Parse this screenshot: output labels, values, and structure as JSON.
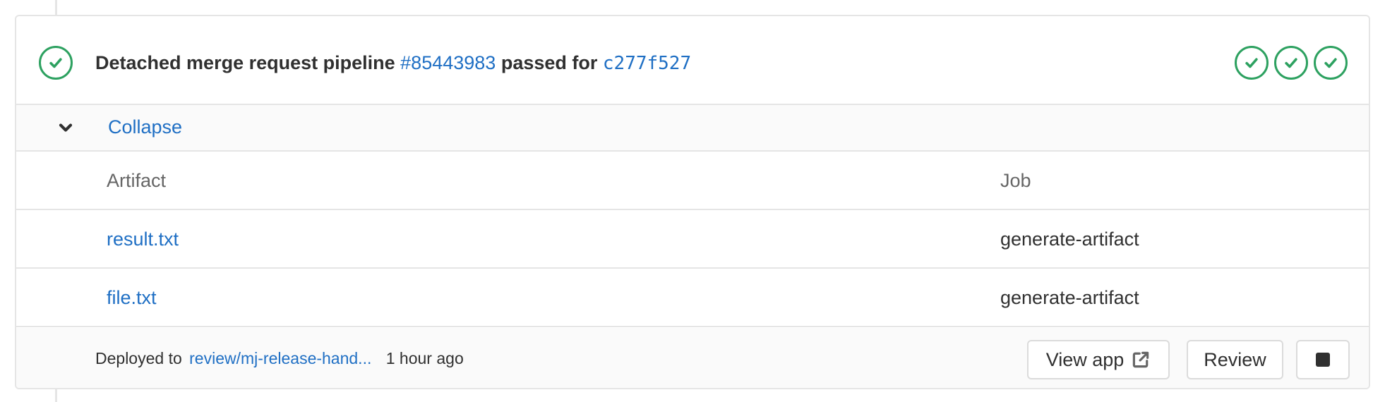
{
  "pipeline": {
    "status": "passed",
    "prefix": "Detached merge request pipeline",
    "id": "#85443983",
    "middle": "passed for",
    "commit": "c277f527",
    "stage_count": 3
  },
  "collapse": {
    "label": "Collapse"
  },
  "artifacts": {
    "headers": [
      "Artifact",
      "Job"
    ],
    "rows": [
      {
        "artifact": "result.txt",
        "job": "generate-artifact"
      },
      {
        "artifact": "file.txt",
        "job": "generate-artifact"
      }
    ]
  },
  "deployment": {
    "prefix": "Deployed to",
    "environment": "review/mj-release-hand...",
    "time": "1 hour ago",
    "view_app_label": "View app",
    "review_label": "Review"
  },
  "colors": {
    "success": "#2da160",
    "link": "#1f6fc4",
    "border": "#e5e5e5"
  },
  "icons": [
    "status-success-icon",
    "chevron-down-icon",
    "external-link-icon",
    "stop-icon"
  ]
}
